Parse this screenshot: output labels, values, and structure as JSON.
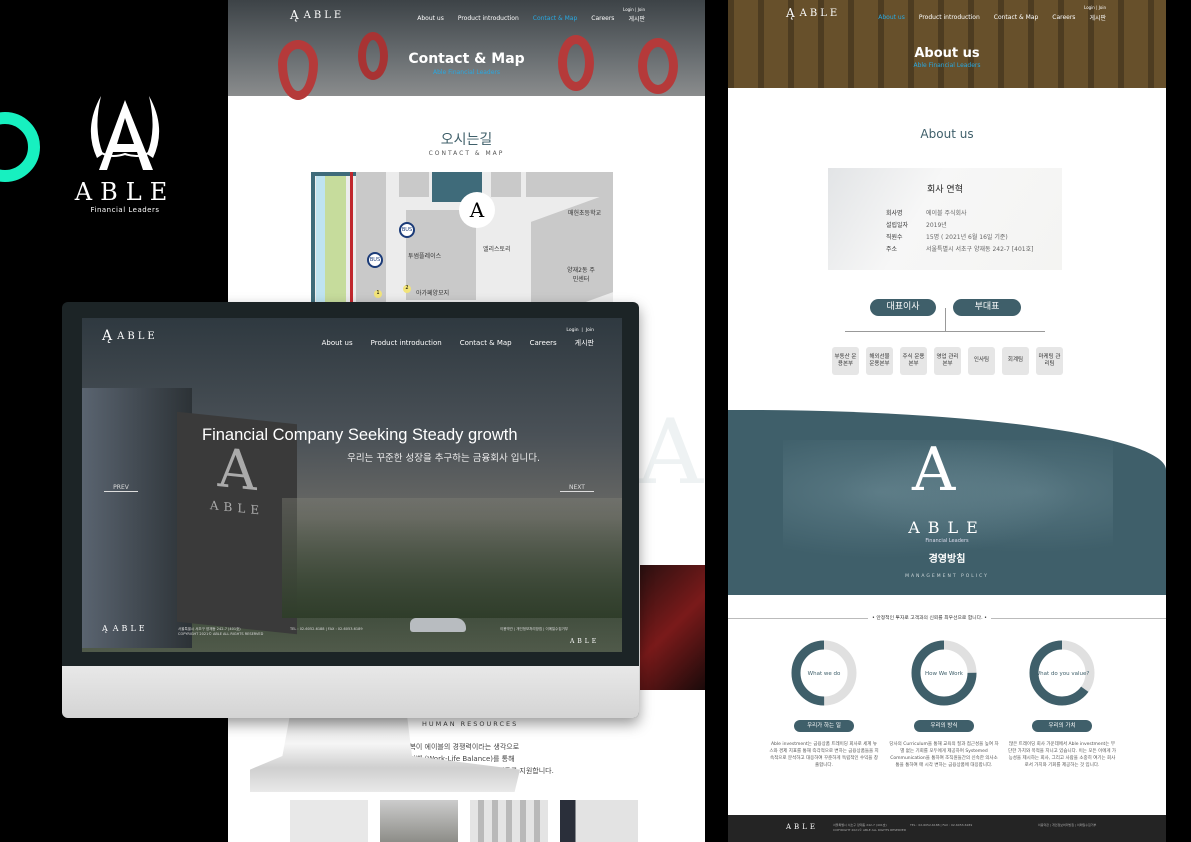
{
  "brand": {
    "name": "ABLE",
    "tagline": "Financial Leaders",
    "accent": "#17f0c0",
    "primary": "#3f5f6a",
    "link": "#29a8e0"
  },
  "nav": {
    "items": [
      "About us",
      "Product introduction",
      "Contact & Map",
      "Careers",
      "게시판"
    ],
    "login": "Login",
    "join": "Join"
  },
  "contact_page": {
    "hero_title": "Contact & Map",
    "hero_sub": "Able Financial Leaders",
    "active_nav": "Contact & Map",
    "section_title": "오시는길",
    "section_sub": "CONTACT & MAP",
    "map_labels": [
      "매헌초등학교",
      "엘리스토리",
      "투썸플레이스",
      "양재2동 주민센터",
      "아가페양모지"
    ],
    "bus": "BUS",
    "stations": [
      "1",
      "2"
    ],
    "hr_title": "HUMAN RESOURCES",
    "hr_lines": [
      "행복이 에이블의 경쟁력이라는 생각으로",
      "워라벨 (Work-Life Balance)를 통해",
      "행복한 일터가 될 수 있도록 복지제도를 지원합니다."
    ]
  },
  "monitor": {
    "headline": "Financial Company Seeking Steady growth",
    "subline": "우리는 꾸준한 성장을 추구하는 금융회사 입니다.",
    "prev": "PREV",
    "next": "NEXT",
    "footer": {
      "address": "서울특별시 서초구 양재동 242-7 (401호)",
      "copyright": "COPYRIGHT 2021© ABLE ALL RIGHTS RESERVED",
      "tel": "TEL : 02-6052-6188",
      "fax": "FAX : 02-6053-6189",
      "links": [
        "이용약관",
        "개인정보처리방침",
        "이메일수집거부"
      ]
    }
  },
  "about_page": {
    "hero_title": "About us",
    "hero_sub": "Able Financial Leaders",
    "active_nav": "About us",
    "section_title": "About us",
    "card": {
      "title": "회사 연혁",
      "rows": [
        {
          "k": "회사명",
          "v": "에이블 주식회사"
        },
        {
          "k": "설립일자",
          "v": "2019년"
        },
        {
          "k": "직원수",
          "v": "15명 ( 2021년 6월 16일 기준)"
        },
        {
          "k": "주소",
          "v": "서울특별시 서초구 양재동 242-7 [401호]"
        }
      ]
    },
    "org": {
      "ceo": "대표이사",
      "vice": "부대표",
      "depts": [
        "부동산 운용본부",
        "해외선물 운용본부",
        "주식 운용본부",
        "영업 관리본부",
        "인사팀",
        "회계팀",
        "마케팅 관리팀"
      ]
    },
    "policy": {
      "title": "경영방침",
      "sub": "MANAGEMENT POLICY",
      "motto": "• 안정적인 투자로 고객과의 신뢰를 최우선으로 합니다. •",
      "items": [
        {
          "circle": "What we do",
          "fill": 0.5,
          "pill": "우리가 하는 일",
          "text": "Able investment는 금융상품 트레이딩 회사로 세계 뉴스와 경제 지표를 통해 즉각적으로 변하는 금융상품들을 지속적으로 분석하고 대응하여 꾸준하게 독립적인 수익을 창출합니다."
        },
        {
          "circle": "How We Work",
          "fill": 0.75,
          "pill": "우리의 방식",
          "text": "당사의 Curriculum을 통해 교육의 질과 접근성을 높여 차별 없는 기회를 모두에게 제공하며 Systemed Communication을 통하여 조직원들간의 신속한 의사소통을 통하여 매 시각 변하는 금융상품에 대응합니다."
        },
        {
          "circle": "What do you value?",
          "fill": 0.65,
          "pill": "우리의 가치",
          "text": "많은 트레이딩 회사 가운데에서 Able investment는 부단한 가치와 목적을 지니고 있습니다. 이는 모든 이에게 가능성을 제시하는 회사, 그리고 사람을 소중히 여기는 회사로서 가치와 기회를 제공하는 것 입니다."
        }
      ]
    }
  }
}
